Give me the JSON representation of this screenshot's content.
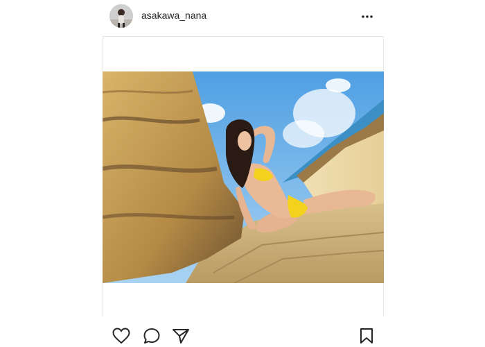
{
  "post": {
    "username": "asakawa_nana"
  },
  "icons": {
    "more": "more-options-icon",
    "like": "heart-icon",
    "comment": "comment-bubble-icon",
    "share": "paper-plane-icon",
    "save": "bookmark-icon"
  },
  "colors": {
    "text": "#262626",
    "sky": "#6ab4ea",
    "sea": "#3c8fc4",
    "rock": "#c9a55e",
    "bikini": "#f2d21c"
  }
}
